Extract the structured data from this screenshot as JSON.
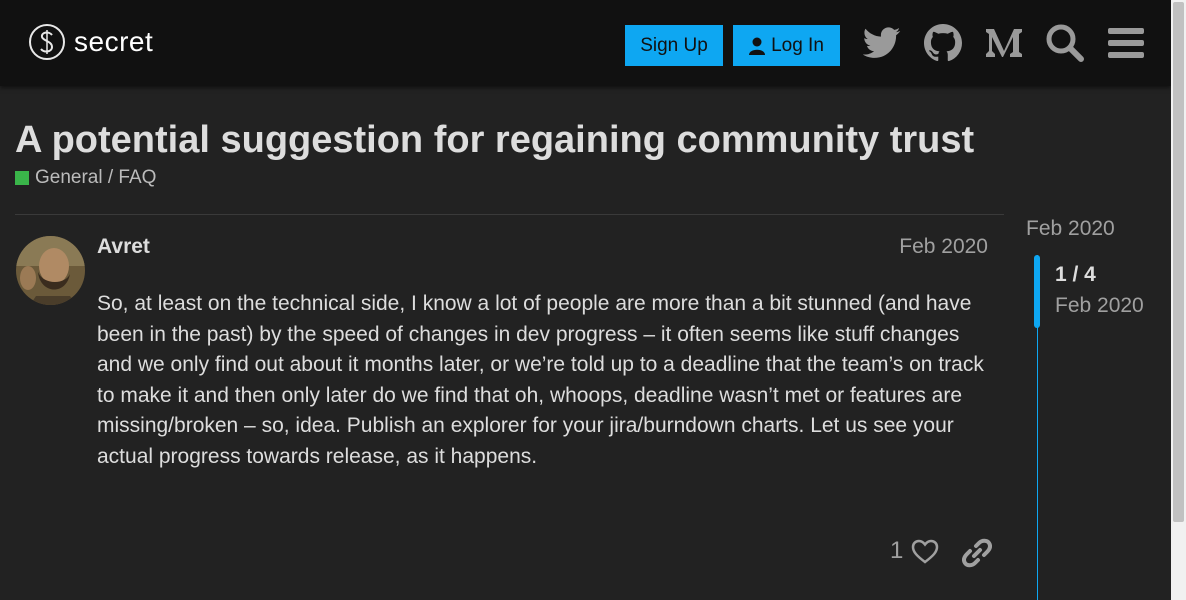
{
  "header": {
    "logo_text": "secret",
    "signup_label": "Sign Up",
    "login_label": "Log In"
  },
  "topic": {
    "title": "A potential suggestion for regaining community trust",
    "category": "General / FAQ",
    "category_color": "#3ab54a"
  },
  "post": {
    "username": "Avret",
    "date": "Feb 2020",
    "body": "So, at least on the technical side, I know a lot of people are more than a bit stunned (and have been in the past) by the speed of changes in dev progress – it often seems like stuff changes and we only find out about it months later, or we’re told up to a deadline that the team’s on track to make it and then only later do we find that oh, whoops, deadline wasn’t met or features are missing/broken – so, idea. Publish an explorer for your jira/burndown charts. Let us see your actual progress towards release, as it happens.",
    "like_count": "1"
  },
  "timeline": {
    "top_date": "Feb 2020",
    "position": "1 / 4",
    "current_date": "Feb 2020"
  },
  "colors": {
    "accent": "#0ea7f2",
    "background": "#222222",
    "header": "#111111"
  },
  "icons": [
    "logo-icon",
    "user-icon",
    "twitter-icon",
    "github-icon",
    "medium-icon",
    "search-icon",
    "hamburger-menu-icon",
    "heart-icon",
    "link-icon"
  ]
}
